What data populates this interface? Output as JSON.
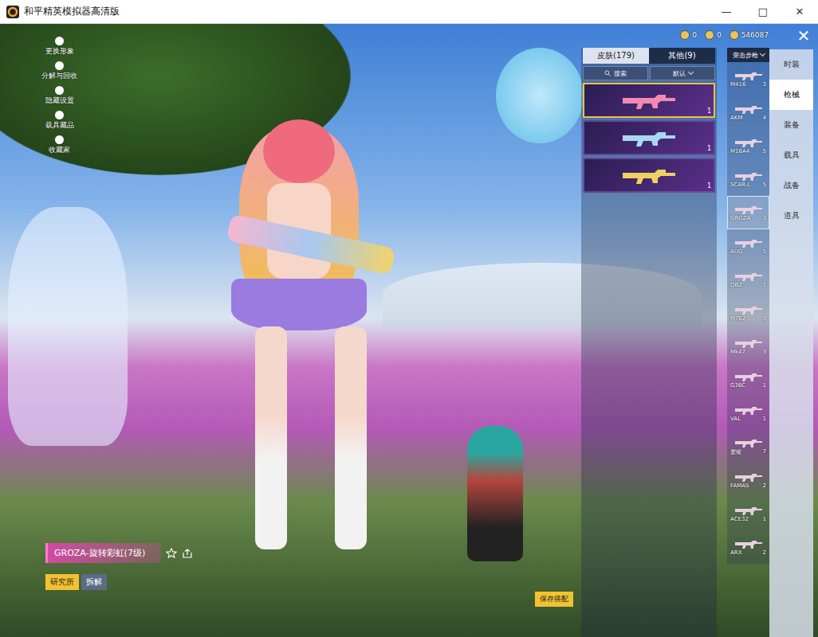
{
  "window": {
    "title": "和平精英模拟器高清版",
    "controls": [
      "—",
      "□",
      "✕"
    ]
  },
  "currencies": [
    {
      "amount": "0"
    },
    {
      "amount": "0"
    },
    {
      "amount": "546087"
    }
  ],
  "close": "✕",
  "side_menu": [
    {
      "label": "更换形象"
    },
    {
      "label": "分解与回收"
    },
    {
      "label": "隐藏设置"
    },
    {
      "label": "载具藏品"
    },
    {
      "label": "收藏家"
    }
  ],
  "skin_panel": {
    "tabs": [
      {
        "label": "皮肤(179)",
        "selected": true
      },
      {
        "label": "其他(9)",
        "selected": false
      }
    ],
    "search": "搜索",
    "sort": "默认",
    "cards": [
      {
        "count": "1",
        "selected": true,
        "color": "#f08ab0"
      },
      {
        "count": "1",
        "selected": false,
        "color": "#a8d8f0"
      },
      {
        "count": "1",
        "selected": false,
        "color": "#f0d060"
      }
    ]
  },
  "category": "突击步枪",
  "weapons": [
    {
      "name": "M416",
      "count": "3",
      "selected": false
    },
    {
      "name": "AKM",
      "count": "4",
      "selected": false
    },
    {
      "name": "M16A4",
      "count": "5",
      "selected": false
    },
    {
      "name": "SCAR-L",
      "count": "5",
      "selected": false
    },
    {
      "name": "GROZA",
      "count": "3",
      "selected": true
    },
    {
      "name": "AUG",
      "count": "5",
      "selected": false
    },
    {
      "name": "QBZ",
      "count": "1",
      "selected": false
    },
    {
      "name": "M762",
      "count": "3",
      "selected": false
    },
    {
      "name": "Mk47",
      "count": "3",
      "selected": false
    },
    {
      "name": "G36C",
      "count": "1",
      "selected": false
    },
    {
      "name": "VAL",
      "count": "1",
      "selected": false
    },
    {
      "name": "蜜獾",
      "count": "7",
      "selected": false
    },
    {
      "name": "FAMAS",
      "count": "2",
      "selected": false
    },
    {
      "name": "ACE32",
      "count": "1",
      "selected": false
    },
    {
      "name": "ARX",
      "count": "2",
      "selected": false
    }
  ],
  "nav": [
    {
      "label": "时装",
      "selected": false
    },
    {
      "label": "枪械",
      "selected": true
    },
    {
      "label": "装备",
      "selected": false
    },
    {
      "label": "载具",
      "selected": false
    },
    {
      "label": "战备",
      "selected": false
    },
    {
      "label": "道具",
      "selected": false
    }
  ],
  "current_skin": {
    "name": "GROZA-旋转彩虹(7级)",
    "actions": [
      "研究所",
      "拆解"
    ]
  },
  "save": "保存搭配"
}
